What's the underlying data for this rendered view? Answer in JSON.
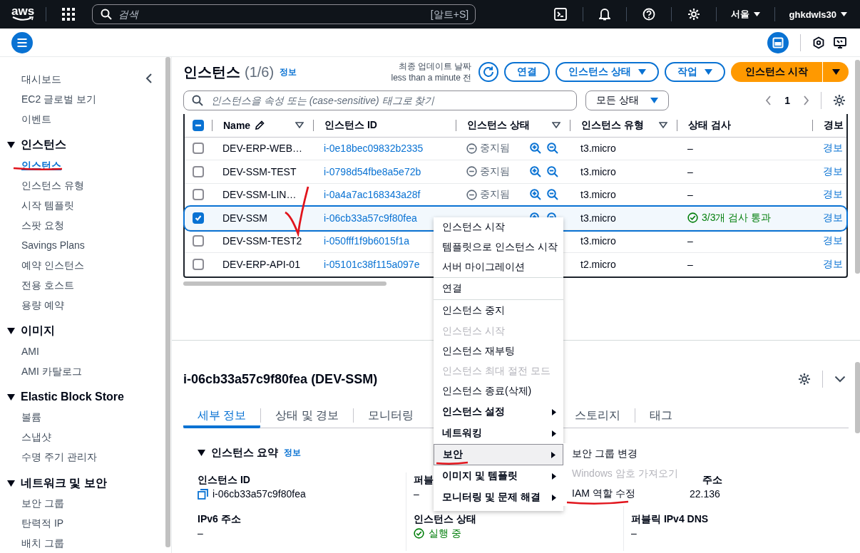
{
  "top_bar": {
    "logo": "aws",
    "search": {
      "placeholder": "검색",
      "shortcut": "[알트+S]"
    },
    "region": "서울",
    "user": "ghkdwls30"
  },
  "sidebar": {
    "items": [
      {
        "label": "대시보드",
        "selected": false
      },
      {
        "label": "EC2 글로벌 보기",
        "selected": false
      },
      {
        "label": "이벤트",
        "selected": false
      }
    ],
    "sections": [
      {
        "title": "인스턴스",
        "expanded": true,
        "items": [
          {
            "label": "인스턴스",
            "selected": true
          },
          {
            "label": "인스턴스 유형",
            "selected": false
          },
          {
            "label": "시작 템플릿",
            "selected": false
          },
          {
            "label": "스팟 요청",
            "selected": false
          },
          {
            "label": "Savings Plans",
            "selected": false
          },
          {
            "label": "예약 인스턴스",
            "selected": false
          },
          {
            "label": "전용 호스트",
            "selected": false
          },
          {
            "label": "용량 예약",
            "selected": false
          }
        ]
      },
      {
        "title": "이미지",
        "expanded": true,
        "items": [
          {
            "label": "AMI",
            "selected": false
          },
          {
            "label": "AMI 카탈로그",
            "selected": false
          }
        ]
      },
      {
        "title": "Elastic Block Store",
        "expanded": true,
        "items": [
          {
            "label": "볼륨",
            "selected": false
          },
          {
            "label": "스냅샷",
            "selected": false
          },
          {
            "label": "수명 주기 관리자",
            "selected": false
          }
        ]
      },
      {
        "title": "네트워크 및 보안",
        "expanded": true,
        "items": [
          {
            "label": "보안 그룹",
            "selected": false
          },
          {
            "label": "탄력적 IP",
            "selected": false
          },
          {
            "label": "배치 그룹",
            "selected": false
          }
        ]
      }
    ]
  },
  "instances": {
    "title": "인스턴스",
    "count": "(1/6)",
    "info": "정보",
    "updated_label": "최종 업데이트 날짜",
    "updated_value": "less than a minute 전",
    "actions": [
      {
        "label": "연결",
        "kind": "plain"
      },
      {
        "label": "인스턴스 상태",
        "kind": "dropdown"
      },
      {
        "label": "작업",
        "kind": "dropdown"
      }
    ],
    "primary": "인스턴스 시작",
    "search_placeholder": "인스턴스을 속성 또는 (case-sensitive) 태그로 찾기",
    "filter": "모든 상태",
    "page": "1",
    "header_checkbox": {
      "indeterminate": true
    },
    "columns": [
      {
        "label": "Name",
        "editable": true,
        "filterable": true
      },
      {
        "label": "인스턴스 ID",
        "editable": false,
        "filterable": false
      },
      {
        "label": "인스턴스 상태",
        "editable": false,
        "filterable": true
      },
      {
        "label": "인스턴스 유형",
        "editable": false,
        "filterable": true
      },
      {
        "label": "상태 검사",
        "editable": false,
        "filterable": false
      },
      {
        "label": "경보",
        "editable": false,
        "filterable": false
      }
    ],
    "rows": [
      {
        "selected": false,
        "name": "DEV-ERP-WEB…",
        "id": "i-0e18bec09832b2335",
        "state": "중지됨",
        "running": false,
        "zoom_controls": true,
        "type": "t3.micro",
        "check": "–",
        "check_passed": false,
        "alarm": "경보"
      },
      {
        "selected": false,
        "name": "DEV-SSM-TEST",
        "id": "i-0798d54fbe8a5e72b",
        "state": "중지됨",
        "running": false,
        "zoom_controls": true,
        "type": "t3.micro",
        "check": "–",
        "check_passed": false,
        "alarm": "경보"
      },
      {
        "selected": false,
        "name": "DEV-SSM-LIN…",
        "id": "i-0a4a7ac168343a28f",
        "state": "중지됨",
        "running": false,
        "zoom_controls": true,
        "type": "t3.micro",
        "check": "–",
        "check_passed": false,
        "alarm": "경보"
      },
      {
        "selected": true,
        "name": "DEV-SSM",
        "id": "i-06cb33a57c9f80fea",
        "zoom_controls": true,
        "type": "t3.micro",
        "check": "3/3개 검사 통과",
        "check_passed": true,
        "alarm": "경보"
      },
      {
        "selected": false,
        "name": "DEV-SSM-TEST2",
        "id": "i-050fff1f9b6015f1a",
        "zoom_controls": false,
        "type": "t3.micro",
        "check": "–",
        "check_passed": false,
        "alarm": "경보"
      },
      {
        "selected": false,
        "name": "DEV-ERP-API-01",
        "id": "i-05101c38f115a097e",
        "zoom_controls": false,
        "type": "t2.micro",
        "check": "–",
        "check_passed": false,
        "alarm": "경보"
      }
    ]
  },
  "details": {
    "title": "i-06cb33a57c9f80fea (DEV-SSM)",
    "tabs": [
      {
        "label": "세부 정보",
        "selected": true
      },
      {
        "label": "상태 및 경보",
        "selected": false
      },
      {
        "label": "모니터링",
        "selected": false
      },
      {
        "label": "스토리지",
        "selected": false
      },
      {
        "label": "태그",
        "selected": false
      }
    ],
    "section": {
      "title": "인스턴스 요약",
      "info": "정보",
      "expanded": true
    },
    "columns": [
      [
        {
          "label": "인스턴스 ID",
          "value": "i-06cb33a57c9f80fea",
          "kind": "copy"
        },
        {
          "label": "IPv6 주소",
          "value": "–",
          "kind": "text"
        }
      ],
      [
        {
          "label": "퍼블",
          "value": "–",
          "kind": "text"
        },
        {
          "label": "인스턴스 상태",
          "value": "실행 중",
          "kind": "status"
        }
      ],
      [
        {
          "label": "주소",
          "value": "22.136",
          "kind": "text"
        },
        {
          "label": "퍼블릭 IPv4 DNS",
          "value": "–",
          "kind": "text"
        }
      ]
    ]
  },
  "menu": {
    "groups": [
      [
        {
          "label": "인스턴스 시작",
          "kind": "action",
          "disabled": false,
          "selected": false
        },
        {
          "label": "템플릿으로 인스턴스 시작",
          "kind": "action",
          "disabled": false,
          "selected": false
        },
        {
          "label": "서버 마이그레이션",
          "kind": "action",
          "disabled": false,
          "selected": false
        }
      ],
      [
        {
          "label": "연결",
          "kind": "action",
          "disabled": false,
          "selected": false
        }
      ],
      [
        {
          "label": "인스턴스 중지",
          "kind": "action",
          "disabled": false,
          "selected": false
        },
        {
          "label": "인스턴스 시작",
          "kind": "action",
          "disabled": true,
          "selected": false
        },
        {
          "label": "인스턴스 재부팅",
          "kind": "action",
          "disabled": false,
          "selected": false
        },
        {
          "label": "인스턴스 최대 절전 모드",
          "kind": "action",
          "disabled": true,
          "selected": false
        },
        {
          "label": "인스턴스 종료(삭제)",
          "kind": "action",
          "disabled": false,
          "selected": false
        }
      ],
      [
        {
          "label": "인스턴스 설정",
          "kind": "submenu",
          "disabled": false,
          "selected": false
        },
        {
          "label": "네트워킹",
          "kind": "submenu",
          "disabled": false,
          "selected": false
        },
        {
          "label": "보안",
          "kind": "submenu",
          "disabled": false,
          "selected": true
        },
        {
          "label": "이미지 및 템플릿",
          "kind": "submenu",
          "disabled": false,
          "selected": false
        },
        {
          "label": "모니터링 및 문제 해결",
          "kind": "submenu",
          "disabled": false,
          "selected": false
        }
      ]
    ]
  },
  "submenu": {
    "items": [
      {
        "label": "보안 그룹 변경",
        "disabled": false
      },
      {
        "label": "Windows 암호 가져오기",
        "disabled": true
      },
      {
        "label": "IAM 역할 수정",
        "disabled": false
      }
    ]
  }
}
